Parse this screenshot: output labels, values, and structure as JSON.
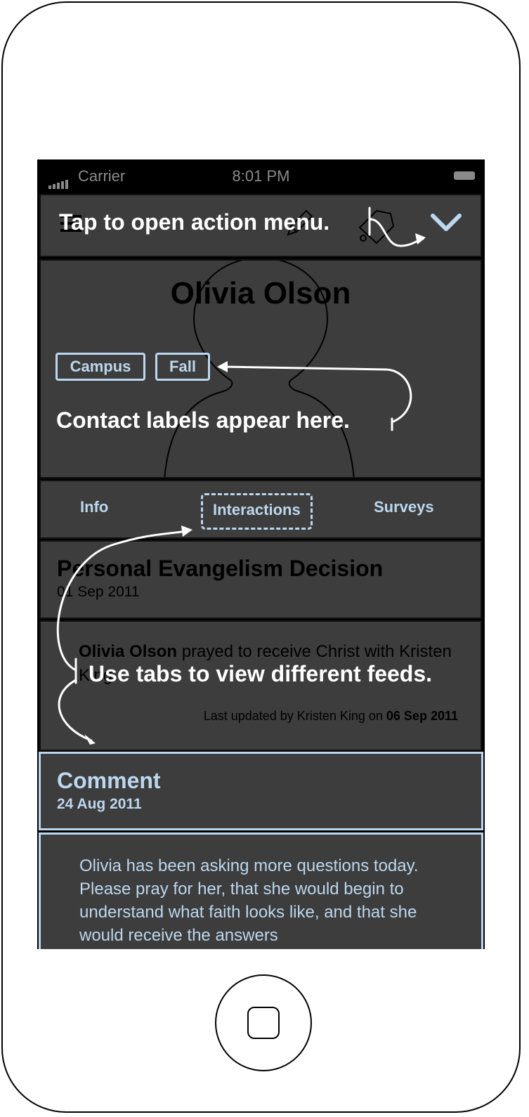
{
  "status_bar": {
    "carrier": "Carrier",
    "time": "8:01 PM"
  },
  "contact": {
    "name": "Olivia Olson",
    "labels": [
      "Campus",
      "Fall"
    ]
  },
  "tabs": [
    {
      "label": "Info",
      "selected": false
    },
    {
      "label": "Interactions",
      "selected": true
    },
    {
      "label": "Surveys",
      "selected": false
    }
  ],
  "feed": [
    {
      "title": "Personal Evangelism Decision",
      "date": "01 Sep 2011",
      "body_name": "Olivia Olson",
      "body_rest": " prayed to receive Christ with Kristen King.",
      "updated_prefix": "Last updated by Kristen King on ",
      "updated_date": "06 Sep 2011"
    },
    {
      "title": "Comment",
      "date": "24 Aug 2011",
      "body": "Olivia has been asking more questions today. Please pray for her, that she would begin to understand what faith looks like, and that she would receive the answers"
    }
  ],
  "annotations": {
    "action_menu": "Tap to open action menu.",
    "labels": "Contact labels appear here.",
    "tabs": "Use tabs to view different feeds."
  },
  "colors": {
    "screen_bg": "#3d3d3d",
    "highlight": "#bcd7ee",
    "annotation": "#ffffff"
  },
  "icons": [
    "menu-icon",
    "pencil-icon",
    "tag-icon",
    "chevron-down-icon",
    "person-silhouette-icon",
    "signal-icon",
    "battery-icon"
  ]
}
